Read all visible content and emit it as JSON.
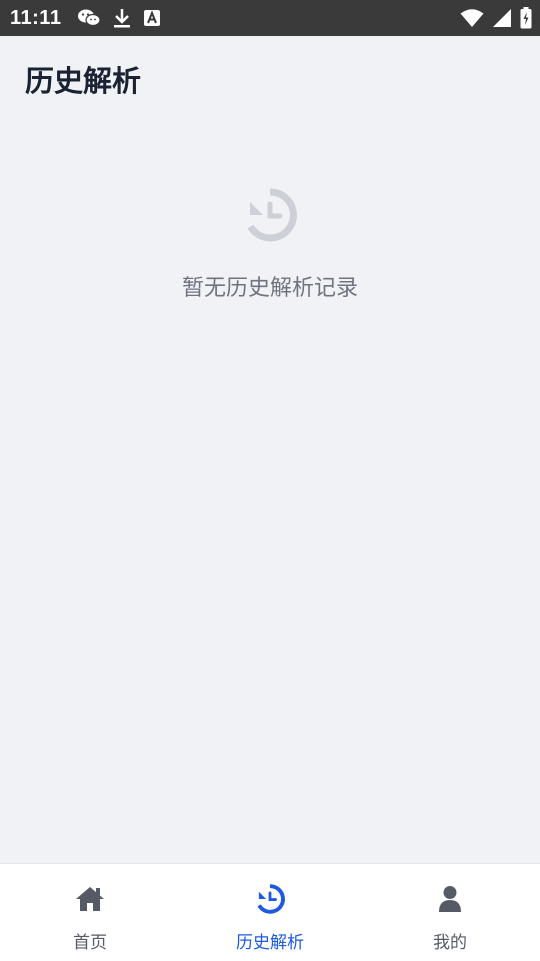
{
  "status_bar": {
    "time": "11:11",
    "left_icons": [
      "wechat-icon",
      "download-icon",
      "a-icon"
    ],
    "right_icons": [
      "wifi-icon",
      "signal-icon",
      "battery-icon"
    ]
  },
  "header": {
    "title": "历史解析"
  },
  "empty_state": {
    "icon": "history-icon",
    "message": "暂无历史解析记录"
  },
  "bottom_nav": {
    "items": [
      {
        "label": "首页",
        "icon": "home-icon",
        "active": false
      },
      {
        "label": "历史解析",
        "icon": "history-icon",
        "active": true
      },
      {
        "label": "我的",
        "icon": "user-icon",
        "active": false
      }
    ]
  },
  "colors": {
    "background": "#f1f2f5",
    "status_bar": "#3a3a3a",
    "accent": "#1d5ae0",
    "inactive": "#555a64",
    "empty_icon": "#cdd0d6"
  }
}
